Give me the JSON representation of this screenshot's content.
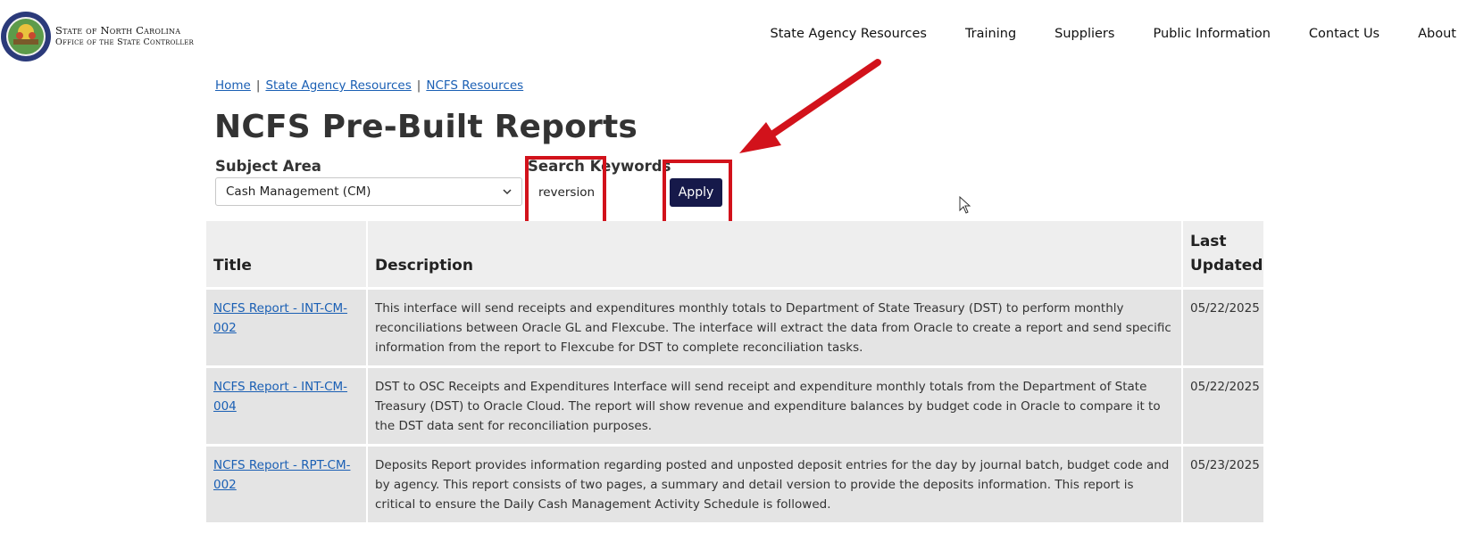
{
  "header": {
    "logo_line1": "State of North Carolina",
    "logo_line2": "Office of the State Controller",
    "nav": [
      "State Agency Resources",
      "Training",
      "Suppliers",
      "Public Information",
      "Contact Us",
      "About"
    ]
  },
  "breadcrumb": [
    "Home",
    "State Agency Resources",
    "NCFS Resources"
  ],
  "page_title": "NCFS Pre-Built Reports",
  "filters": {
    "subject_label": "Subject Area",
    "subject_value": "Cash Management (CM)",
    "search_label": "Search Keywords",
    "search_value": "reversion",
    "apply_label": "Apply"
  },
  "table": {
    "headers": [
      "Title",
      "Description",
      "Last Updated"
    ],
    "rows": [
      {
        "title": "NCFS Report - INT-CM-002",
        "description": "This interface will send receipts and expenditures monthly totals to Department of State Treasury (DST) to perform monthly reconciliations between Oracle GL and Flexcube. The interface will extract the data from Oracle to create a report and send specific information from the report to Flexcube for DST to complete reconciliation tasks.",
        "updated": "05/22/2025"
      },
      {
        "title": "NCFS Report - INT-CM-004",
        "description": "DST to OSC Receipts and Expenditures Interface will send receipt and expenditure monthly totals from the Department of State Treasury (DST) to Oracle Cloud. The report will show revenue and expenditure balances by budget code in Oracle to compare it to the DST data sent for reconciliation purposes.",
        "updated": "05/22/2025"
      },
      {
        "title": "NCFS Report - RPT-CM-002",
        "description": "Deposits Report provides information regarding posted and unposted deposit entries for the day by journal batch, budget code and by agency. This report consists of two pages, a summary and detail version to provide the deposits information. This report is critical to ensure the Daily Cash Management Activity Schedule is followed.",
        "updated": "05/23/2025"
      }
    ]
  },
  "colors": {
    "annotation_red": "#d2121b",
    "apply_button": "#16194a",
    "link_blue": "#1a5fb4"
  }
}
